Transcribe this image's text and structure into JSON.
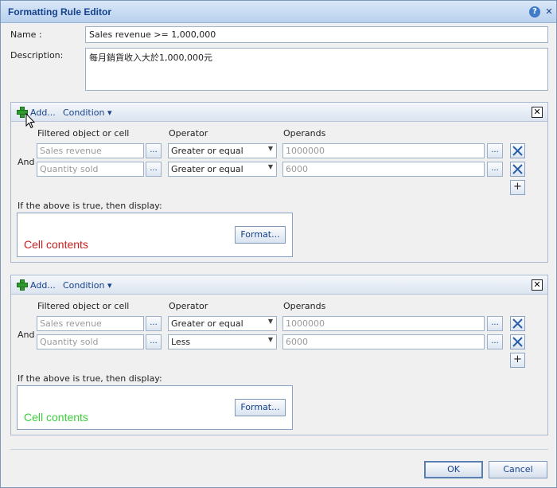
{
  "window": {
    "title": "Formatting Rule Editor"
  },
  "form": {
    "name_label": "Name :",
    "name_value": "Sales revenue >= 1,000,000",
    "description_label": "Description:",
    "description_value": "每月銷貨收入大於1,000,000元"
  },
  "columns": {
    "object": "Filtered object or cell",
    "operator": "Operator",
    "operands": "Operands"
  },
  "toolbar": {
    "add_label": "Add...",
    "condition_label": "Condition ▾"
  },
  "and_label": "And",
  "ellipsis": "...",
  "display_caption": "If the above is true, then display:",
  "format_label": "Format...",
  "rules": [
    {
      "conditions": [
        {
          "object": "Sales revenue",
          "operator": "Greater or equal",
          "operand": "1000000"
        },
        {
          "object": "Quantity sold",
          "operator": "Greater or equal",
          "operand": "6000"
        }
      ],
      "display_text": "Cell contents",
      "display_color": "#cc1f1f"
    },
    {
      "conditions": [
        {
          "object": "Sales revenue",
          "operator": "Greater or equal",
          "operand": "1000000"
        },
        {
          "object": "Quantity sold",
          "operator": "Less",
          "operand": "6000"
        }
      ],
      "display_text": "Cell contents",
      "display_color": "#3ad13a"
    }
  ],
  "buttons": {
    "ok": "OK",
    "cancel": "Cancel"
  },
  "icons": {
    "help": "?",
    "close": "✕",
    "panel_close": "✕",
    "add_row": "+"
  }
}
